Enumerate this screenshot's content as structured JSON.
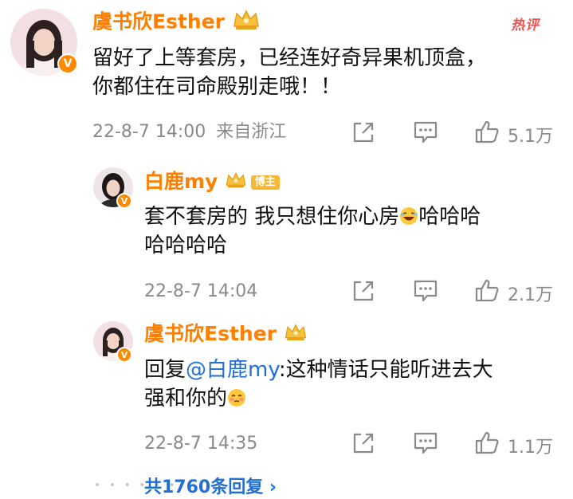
{
  "hot_label": "热评",
  "comments": [
    {
      "author": "虞书欣Esther",
      "text_line1": "留好了上等套房，已经连好奇异果机顶盒，",
      "text_line2": "你都住在司命殿别走哦！！",
      "timestamp": "22-8-7 14:00",
      "location": "来自浙江",
      "likes": "5.1万"
    },
    {
      "author": "白鹿my",
      "badge": "博主",
      "text_line1": "套不套房的 我只想住你心房",
      "text_line1_tail": "哈哈哈",
      "text_line2": "哈哈哈哈",
      "timestamp": "22-8-7 14:04",
      "likes": "2.1万"
    },
    {
      "author": "虞书欣Esther",
      "reply_prefix": "回复",
      "mention": "@白鹿my",
      "text_after_mention": ":这种情话只能听进去大",
      "text_line2": "强和你的",
      "timestamp": "22-8-7 14:35",
      "likes": "1.1万"
    }
  ],
  "replies_link": "共1760条回复 ›",
  "colors": {
    "author_name": "#ff7f00",
    "hot_label": "#f0534e",
    "link": "#1f6fd6",
    "meta": "#8a8a8a"
  },
  "icons": [
    "verified-badge-icon",
    "crown-badge-icon",
    "share-icon",
    "comment-icon",
    "thumbs-up-icon",
    "laughing-emoji-icon",
    "shy-emoji-icon",
    "chevron-right-icon"
  ]
}
